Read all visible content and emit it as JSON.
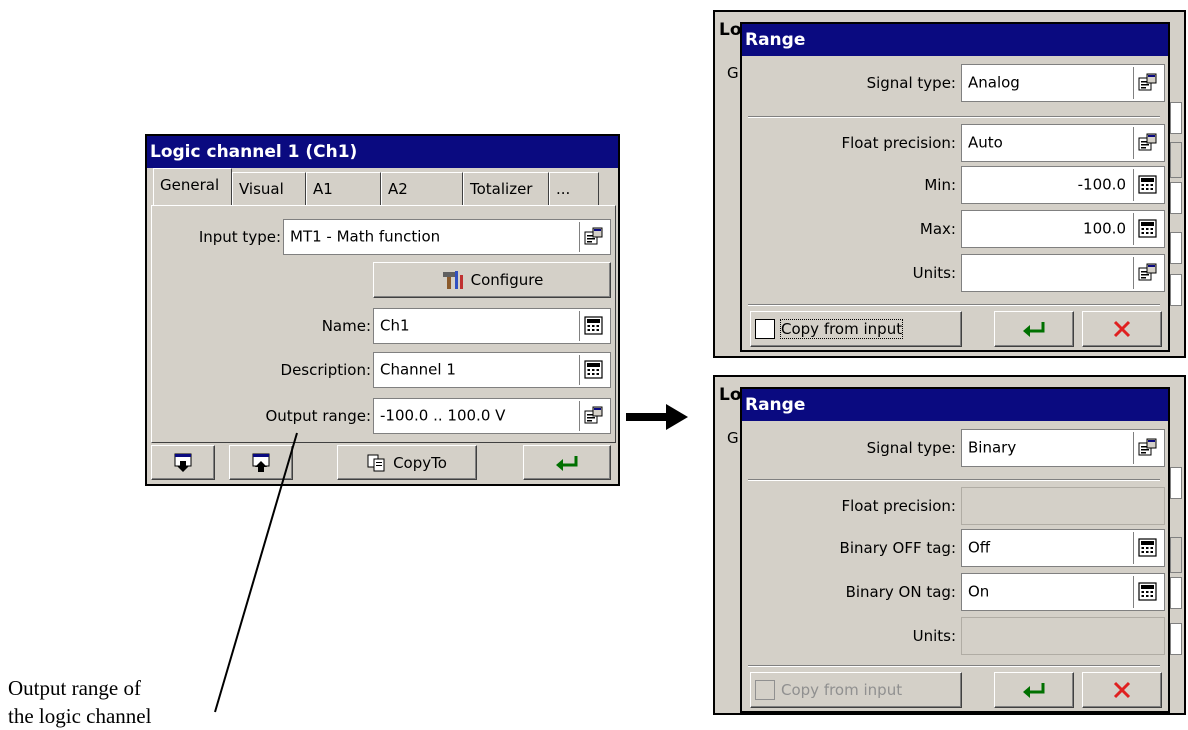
{
  "main_window": {
    "title": "Logic channel 1 (Ch1)",
    "tabs": [
      "General",
      "Visual",
      "A1",
      "A2",
      "Totalizer",
      "..."
    ],
    "input_type_label": "Input type:",
    "input_type_value": "MT1 - Math function",
    "configure_label": "Configure",
    "name_label": "Name:",
    "name_value": "Ch1",
    "description_label": "Description:",
    "description_value": "Channel 1",
    "output_range_label": "Output range:",
    "output_range_value": "-100.0 .. 100.0 V",
    "copyto_label": "CopyTo"
  },
  "range_analog": {
    "bg_title": "Lo",
    "bg_letter": "G",
    "title": "Range",
    "signal_type_label": "Signal type:",
    "signal_type_value": "Analog",
    "float_precision_label": "Float precision:",
    "float_precision_value": "Auto",
    "min_label": "Min:",
    "min_value": "-100.0",
    "max_label": "Max:",
    "max_value": "100.0",
    "units_label": "Units:",
    "units_value": "",
    "copy_from_input_label": "Copy from input"
  },
  "range_binary": {
    "bg_title": "Lo",
    "bg_letter": "G",
    "title": "Range",
    "signal_type_label": "Signal type:",
    "signal_type_value": "Binary",
    "float_precision_label": "Float precision:",
    "binary_off_label": "Binary OFF tag:",
    "binary_off_value": "Off",
    "binary_on_label": "Binary ON tag:",
    "binary_on_value": "On",
    "units_label": "Units:",
    "copy_from_input_label": "Copy from input"
  },
  "caption": {
    "line1": "Output range of",
    "line2": "the logic channel"
  },
  "icons": {
    "select": "property-sheet-icon",
    "keypad": "calculator-keypad-icon",
    "enter": "enter-arrow-icon",
    "cancel": "red-x-icon",
    "configure": "tools-icon",
    "copy": "copy-icon"
  },
  "colors": {
    "title_bar": "#0a0a80",
    "dialog_bg": "#d4d0c8",
    "enter_green": "#007000",
    "cancel_red": "#e02020"
  }
}
